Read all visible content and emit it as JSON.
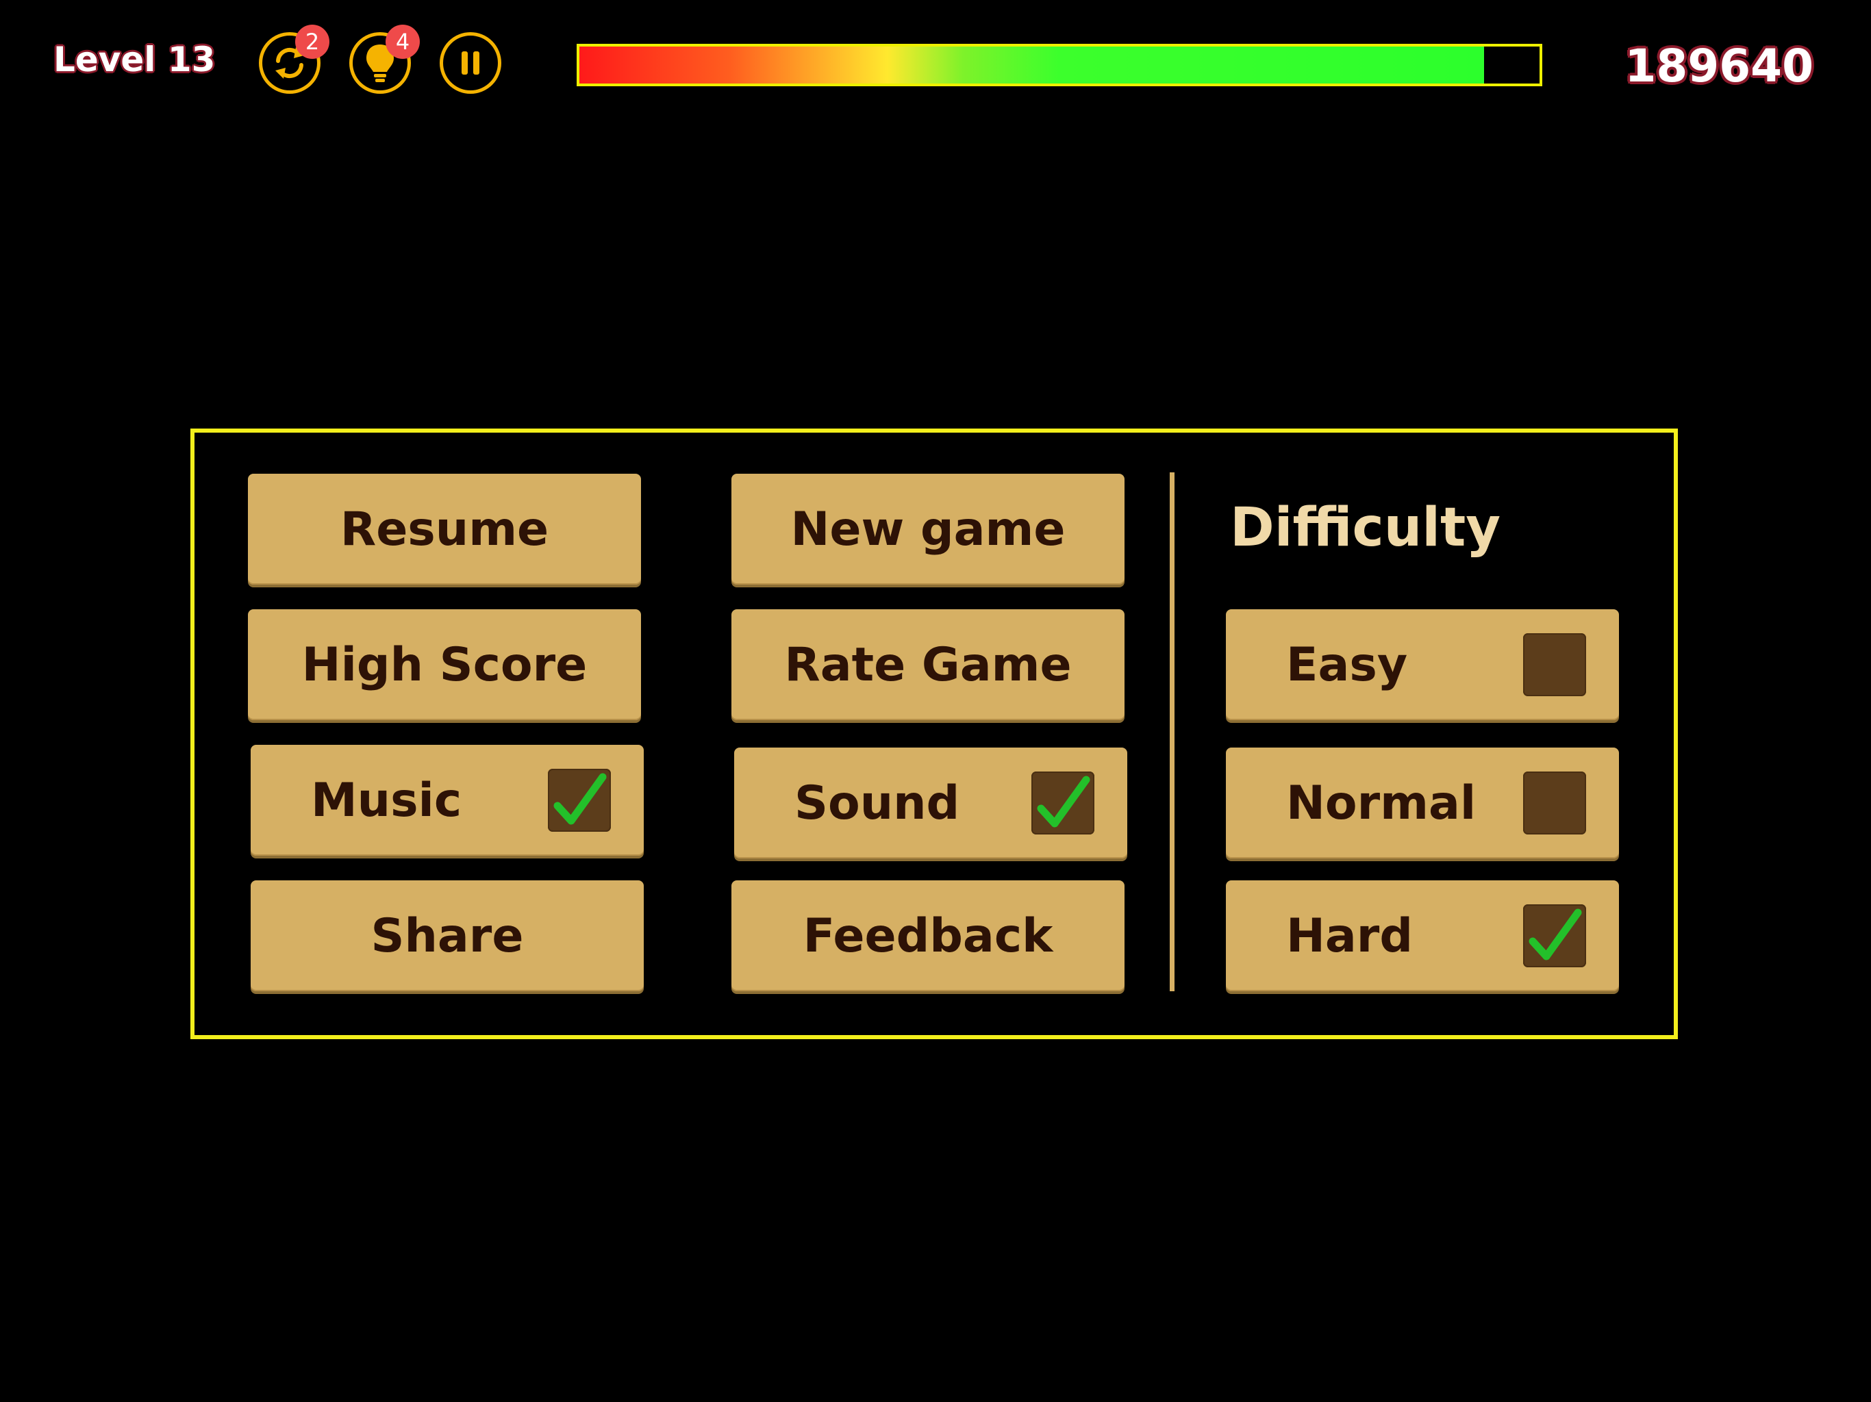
{
  "hud": {
    "level": "Level 13",
    "score": "189640",
    "undo_badge": "2",
    "hint_badge": "4",
    "health_fraction": 0.942,
    "accent_color": "#f5b301",
    "icons": {
      "undo": "refresh-icon",
      "hint": "lightbulb-icon",
      "pause": "pause-icon"
    }
  },
  "menu": {
    "resume": "Resume",
    "new_game": "New game",
    "high_score": "High Score",
    "rate_game": "Rate Game",
    "music": "Music",
    "music_on": true,
    "sound": "Sound",
    "sound_on": true,
    "share": "Share",
    "feedback": "Feedback"
  },
  "difficulty": {
    "title": "Difficulty",
    "options": [
      {
        "label": "Easy",
        "checked": false
      },
      {
        "label": "Normal",
        "checked": false
      },
      {
        "label": "Hard",
        "checked": true
      }
    ]
  },
  "colors": {
    "panel_border": "#f3ef1c",
    "button_bg": "#d6b064",
    "button_text": "#2d1206",
    "checkbox_bg": "#5c3d1b",
    "checkmark": "#23c02a"
  }
}
